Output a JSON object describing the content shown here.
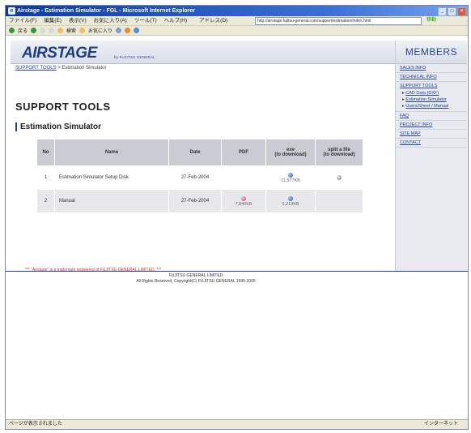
{
  "window": {
    "title": "Airstage - Estimation Simulator - FGL - Microsoft Internet Explorer",
    "menu": [
      "ファイル(F)",
      "編集(E)",
      "表示(V)",
      "お気に入り(A)",
      "ツール(T)",
      "ヘルプ(H)"
    ],
    "address_label": "アドレス(D)",
    "address": "http://airstage.fujitsu-general.com/support/estimation/index.html",
    "go_label": "移動",
    "toolbar": [
      "戻る",
      "検索",
      "お気に入り"
    ],
    "status_left": "ページが表示されました",
    "status_right": "インターネット"
  },
  "header": {
    "logo": "AIRSTAGE",
    "logo_sub": "by FUJITSU GENERAL",
    "members": "MEMBERS"
  },
  "breadcrumb": {
    "link": "SUPPORT TOOLS",
    "separator": " > ",
    "current": "Estimation Simulator"
  },
  "page_title": "SUPPORT TOOLS",
  "section_title": "Estimation Simulator",
  "table": {
    "headers": [
      "No",
      "Name",
      "Date",
      "PDF",
      "exe\n(to download)",
      "split a file\n(to download)"
    ],
    "rows": [
      {
        "no": "1",
        "name": "Estimation Simulator Setup Disk",
        "date": "27-Feb-2004",
        "pdf": "",
        "pdf_size": "",
        "exe": "yes",
        "exe_size": "11,577KB",
        "split": "yes"
      },
      {
        "no": "2",
        "name": "Manual",
        "date": "27-Feb-2004",
        "pdf": "yes",
        "pdf_size": "7,840KB",
        "exe": "yes",
        "exe_size": "5,219KB",
        "split": ""
      }
    ]
  },
  "trademark": "*** \"Airstage\" is a trademark registered of FUJITSU GENERAL LIMITED. ***",
  "footer": {
    "company": "FUJITSU GENERAL LIMITED",
    "copyright": "All Rights Reserved, Copyright(C) FUJITSU GENERAL 1996-2005"
  },
  "sidebar": {
    "items": [
      "SALES INFO",
      "TECHNICAL INFO",
      "SUPPORT TOOLS"
    ],
    "subitems": [
      "CAD Data (DXF)",
      "Estimation Simulator",
      "Users/Sheet / Manual"
    ],
    "items_after": [
      "FAQ",
      "PROJECT INFO",
      "SITE MAP",
      "CONTACT"
    ]
  }
}
